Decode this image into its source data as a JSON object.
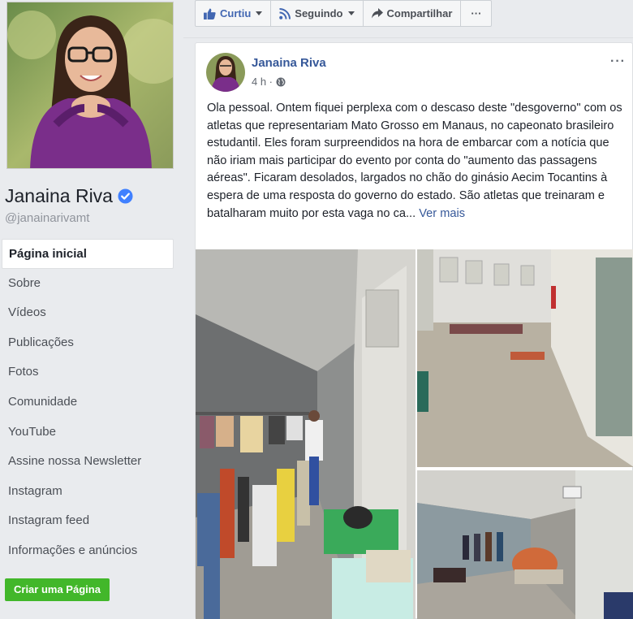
{
  "profile": {
    "name": "Janaina Riva",
    "handle": "@janainarivamt"
  },
  "nav": {
    "items": [
      {
        "label": "Página inicial"
      },
      {
        "label": "Sobre"
      },
      {
        "label": "Vídeos"
      },
      {
        "label": "Publicações"
      },
      {
        "label": "Fotos"
      },
      {
        "label": "Comunidade"
      },
      {
        "label": "YouTube"
      },
      {
        "label": "Assine nossa Newsletter"
      },
      {
        "label": "Instagram"
      },
      {
        "label": "Instagram feed"
      },
      {
        "label": "Informações e anúncios"
      }
    ],
    "create_page_label": "Criar uma Página"
  },
  "actionbar": {
    "like_label": "Curtiu",
    "follow_label": "Seguindo",
    "share_label": "Compartilhar",
    "more_label": "···"
  },
  "post": {
    "author": "Janaina Riva",
    "time": "4 h ·",
    "more": "···",
    "text": "Ola pessoal. Ontem fiquei perplexa com o descaso deste \"desgoverno\" com os atletas que representariam Mato Grosso em Manaus, no capeonato brasileiro estudantil. Eles foram surpreendidos na hora de embarcar com a notícia que não iriam mais participar do evento por conta do \"aumento das passagens aéreas\". Ficaram desolados, largados no chão do ginásio Aecim Tocantins à espera de uma resposta do governo do estado. São atletas que treinaram e batalharam muito por esta vaga no ca...",
    "see_more": "Ver mais"
  },
  "colors": {
    "link": "#365899",
    "button_green": "#42b72a",
    "background": "#e9ebee",
    "verified": "#4080ff"
  }
}
